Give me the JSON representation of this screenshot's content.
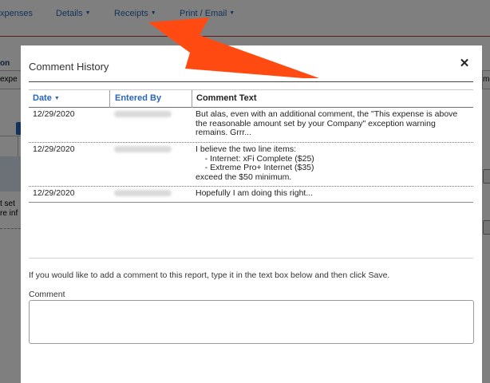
{
  "background": {
    "nav": {
      "items": [
        {
          "label": "xpenses",
          "caret": ""
        },
        {
          "label": "Details",
          "caret": "▼"
        },
        {
          "label": "Receipts",
          "caret": "▼"
        },
        {
          "label": "Print / Email",
          "caret": "▼"
        }
      ]
    },
    "fragments": {
      "on": "on",
      "expe": "expe",
      "me": "me",
      "t_set": "t set",
      "re_inf": "re inf"
    }
  },
  "modal": {
    "title": "Comment History",
    "close_glyph": "✕",
    "table": {
      "headers": {
        "date": "Date",
        "sort_glyph": "▼",
        "entered_by": "Entered By",
        "comment_text": "Comment Text"
      },
      "rows": [
        {
          "date": "12/29/2020",
          "text": "But alas, even with an additional comment, the \"This expense is above the reasonable amount set by your Company\" exception warning remains. Grrr..."
        },
        {
          "date": "12/29/2020",
          "text": "I believe the two line items:\n    - Internet: xFi Complete ($25)\n    - Extreme Pro+ Internet ($35)\nexceed the $50 minimum."
        },
        {
          "date": "12/29/2020",
          "text": "Hopefully I am doing this right..."
        }
      ]
    },
    "instructions": "If you would like to add a comment to this report, type it in the text box below and then click Save.",
    "comment_label": "Comment",
    "comment_value": ""
  },
  "colors": {
    "link_blue": "#2b64b5",
    "arrow_orange": "#ff4a12",
    "header_red_line": "#c0392b"
  }
}
